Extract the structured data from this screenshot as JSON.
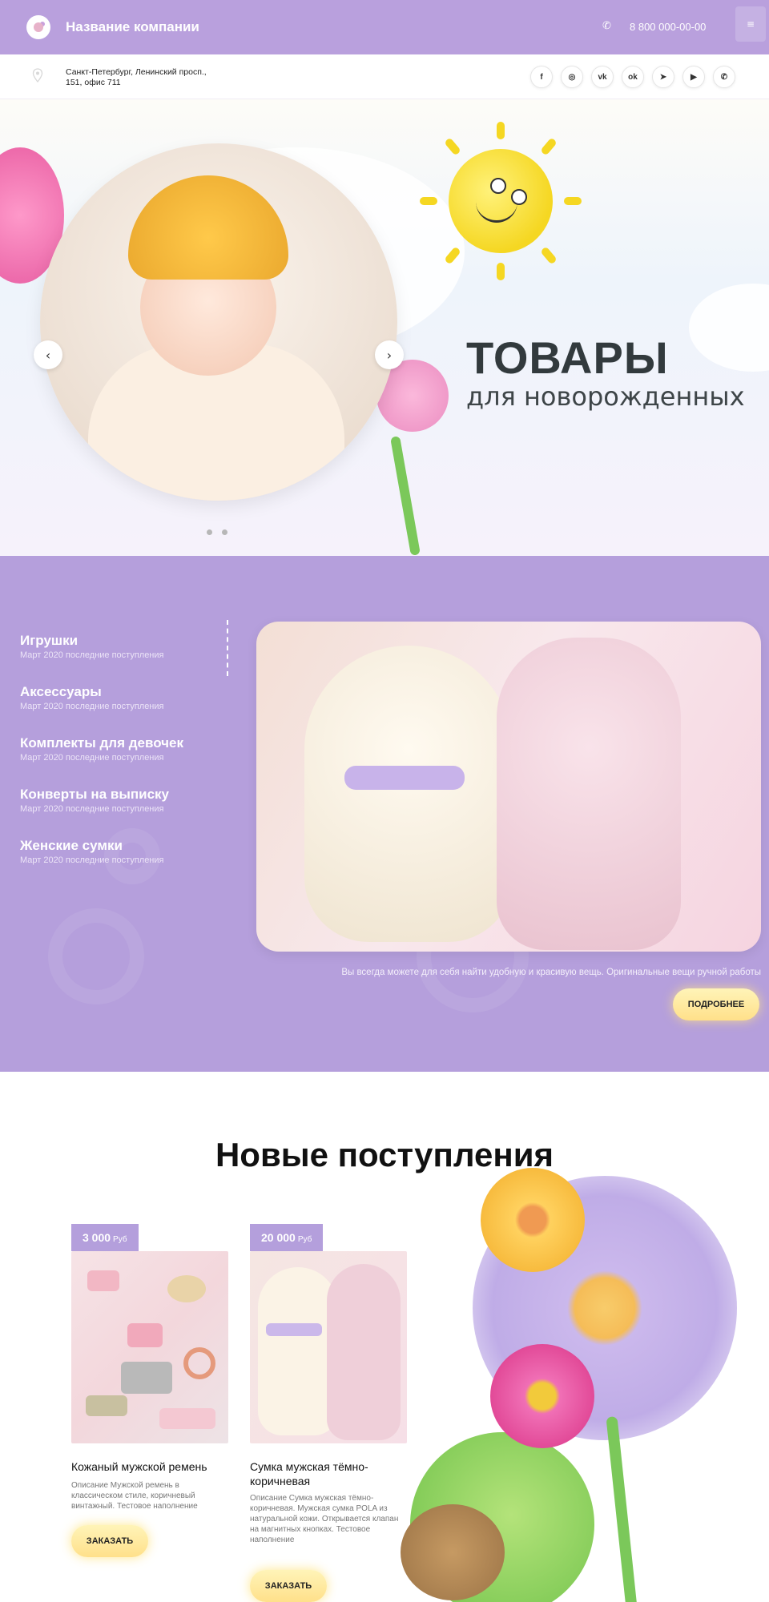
{
  "header": {
    "company_name": "Название компании",
    "phone": "8 800 000-00-00",
    "menu_icon": "≡"
  },
  "address": {
    "line1": "Санкт-Петербург, Ленинский просп.,",
    "line2": "151, офис 711"
  },
  "socials": [
    {
      "name": "facebook",
      "glyph": "f"
    },
    {
      "name": "instagram",
      "glyph": "◎"
    },
    {
      "name": "vk",
      "glyph": "vk"
    },
    {
      "name": "odnoklassniki",
      "glyph": "ok"
    },
    {
      "name": "telegram",
      "glyph": "➤"
    },
    {
      "name": "youtube",
      "glyph": "▶"
    },
    {
      "name": "whatsapp",
      "glyph": "✆"
    }
  ],
  "hero": {
    "title": "ТОВАРЫ",
    "subtitle": "для новорожденных",
    "prev": "‹",
    "next": "›"
  },
  "categories": [
    {
      "name": "Игрушки",
      "sub": "Март 2020 последние поступления"
    },
    {
      "name": "Аксессуары",
      "sub": "Март 2020 последние поступления"
    },
    {
      "name": "Комплекты для девочек",
      "sub": "Март 2020 последние поступления"
    },
    {
      "name": "Конверты на выписку",
      "sub": "Март 2020 последние поступления"
    },
    {
      "name": "Женские сумки",
      "sub": "Март 2020 последние поступления"
    }
  ],
  "category_note": "Вы всегда можете для себя найти удобную и красивую вещь. Оригинальные вещи ручной работы",
  "more_button": "ПОДРОБНЕЕ",
  "new_arrivals": {
    "title": "Новые поступления",
    "products": [
      {
        "price": "3 000",
        "currency": "Руб",
        "title": "Кожаный мужской ремень",
        "description": "Описание Мужской ремень в классическом стиле, коричневый винтажный. Тестовое наполнение",
        "button": "ЗАКАЗАТЬ"
      },
      {
        "price": "20 000",
        "currency": "Руб",
        "title": "Сумка мужская тёмно-коричневая",
        "description": "Описание Сумка мужская тёмно-коричневая. Мужская сумка POLA из натуральной кожи. Открывается клапан на магнитных кнопках. Тестовое наполнение",
        "button": "ЗАКАЗАТЬ"
      }
    ]
  },
  "colors": {
    "brand_purple": "#b9a0dd",
    "button_yellow": "#ffe08a"
  }
}
